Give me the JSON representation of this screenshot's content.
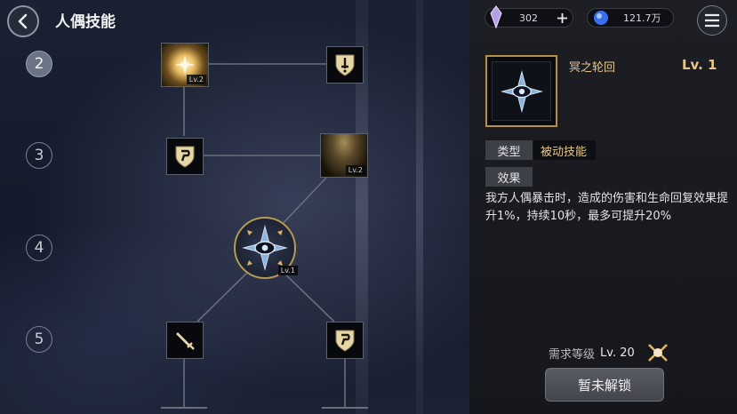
{
  "header": {
    "title": "人偶技能"
  },
  "tiers": [
    "2",
    "3",
    "4",
    "5"
  ],
  "tree": {
    "nodes": [
      {
        "name": "starlight-burst",
        "level": "Lv.2"
      },
      {
        "name": "shield-sword",
        "level": ""
      },
      {
        "name": "shield-emblem",
        "level": ""
      },
      {
        "name": "dusk-aura",
        "level": "Lv.2"
      },
      {
        "name": "nether-wheel",
        "level": "Lv.1"
      },
      {
        "name": "sword-strike",
        "level": ""
      },
      {
        "name": "shield-emblem-2",
        "level": ""
      }
    ]
  },
  "resources": {
    "crystal": "302",
    "gold": "121.7万"
  },
  "skill": {
    "name": "冥之轮回",
    "level": "Lv. 1",
    "type_label": "类型",
    "type_value": "被动技能",
    "effect_label": "效果",
    "description": "我方人偶暴击时，造成的伤害和生命回复效果提升1%，持续10秒，最多可提升20%"
  },
  "requirement": {
    "label": "需求等级",
    "value": "Lv. 20"
  },
  "unlock_button": "暂未解锁",
  "colors": {
    "accent_gold": "#e9c686",
    "frame_gold": "#b98f45"
  }
}
